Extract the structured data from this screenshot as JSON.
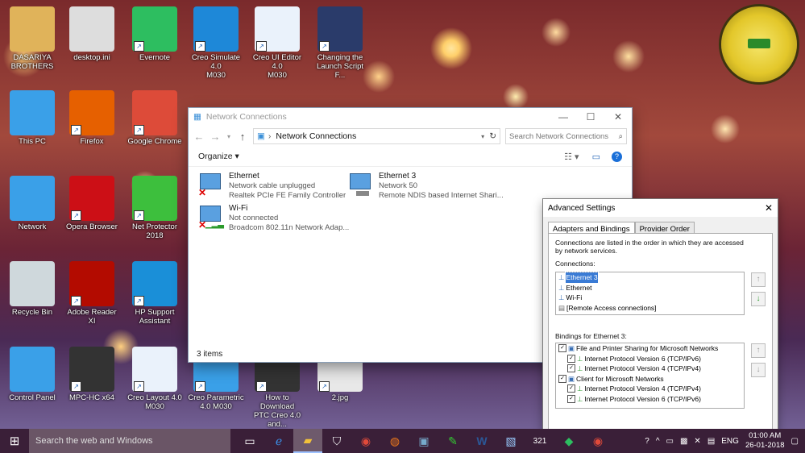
{
  "desktop_icons": [
    {
      "label": "DASARIYA\nBROTHERS",
      "icon": "user-folder-icon",
      "color": "#e0b35a"
    },
    {
      "label": "desktop.ini",
      "icon": "file-icon",
      "color": "#dddddd"
    },
    {
      "label": "Evernote",
      "icon": "evernote-icon",
      "color": "#2dbe60"
    },
    {
      "label": "Creo Simulate 4.0\nM030",
      "icon": "creo-simulate-icon",
      "color": "#1e88d8"
    },
    {
      "label": "Creo UI Editor 4.0\nM030",
      "icon": "creo-ui-editor-icon",
      "color": "#eaf2fb"
    },
    {
      "label": "Changing the\nLaunch Script F...",
      "icon": "video-file-icon",
      "color": "#2a3b6a"
    },
    {
      "label": "This PC",
      "icon": "this-pc-icon",
      "color": "#3aa0e8"
    },
    {
      "label": "Firefox",
      "icon": "firefox-icon",
      "color": "#e66000"
    },
    {
      "label": "Google Chrome",
      "icon": "chrome-icon",
      "color": "#dd4b39"
    },
    {
      "label": "Network",
      "icon": "network-icon",
      "color": "#3aa0e8"
    },
    {
      "label": "Opera Browser",
      "icon": "opera-icon",
      "color": "#cc0f16"
    },
    {
      "label": "Net Protector 2018",
      "icon": "net-protector-icon",
      "color": "#3dbf3d"
    },
    {
      "label": "Recycle Bin",
      "icon": "recycle-bin-icon",
      "color": "#cfd8dc"
    },
    {
      "label": "Adobe Reader XI",
      "icon": "adobe-reader-icon",
      "color": "#b30b00"
    },
    {
      "label": "HP Support\nAssistant",
      "icon": "hp-support-icon",
      "color": "#1a8fd8"
    },
    {
      "label": "Control Panel",
      "icon": "control-panel-icon",
      "color": "#3aa0e8"
    },
    {
      "label": "MPC-HC x64",
      "icon": "mpc-hc-icon",
      "color": "#333333"
    },
    {
      "label": "Creo Layout 4.0\nM030",
      "icon": "creo-layout-icon",
      "color": "#eaf2fb"
    },
    {
      "label": "Creo Parametric\n4.0 M030",
      "icon": "creo-parametric-icon",
      "color": "#3aa0e8"
    },
    {
      "label": "How to Download\nPTC Creo 4.0 and...",
      "icon": "video-file-icon",
      "color": "#333333"
    },
    {
      "label": "2.jpg",
      "icon": "image-file-icon",
      "color": "#e8e8e8"
    }
  ],
  "network_window": {
    "title": "Network Connections",
    "address": "Network Connections",
    "search_placeholder": "Search Network Connections",
    "organize_label": "Organize ▾",
    "status": "3 items",
    "connections": [
      {
        "name": "Ethernet",
        "line1": "Network cable unplugged",
        "line2": "Realtek PCIe FE Family Controller",
        "state": "disconnected"
      },
      {
        "name": "Ethernet 3",
        "line1": "Network  50",
        "line2": "Remote NDIS based Internet Shari...",
        "state": "connected"
      },
      {
        "name": "Wi-Fi",
        "line1": "Not connected",
        "line2": "Broadcom 802.11n Network Adap...",
        "state": "disconnected"
      }
    ]
  },
  "advanced_settings": {
    "title": "Advanced Settings",
    "tabs": [
      "Adapters and Bindings",
      "Provider Order"
    ],
    "description": "Connections are listed in the order in which they are accessed by network services.",
    "connections_label": "Connections:",
    "connections": [
      "Ethernet 3",
      "Ethernet",
      "Wi-Fi",
      "[Remote Access connections]"
    ],
    "bindings_label": "Bindings for Ethernet 3:",
    "bindings": [
      {
        "text": "File and Printer Sharing for Microsoft Networks",
        "level": 0
      },
      {
        "text": "Internet Protocol Version 6 (TCP/IPv6)",
        "level": 1
      },
      {
        "text": "Internet Protocol Version 4 (TCP/IPv4)",
        "level": 1
      },
      {
        "text": "Client for Microsoft Networks",
        "level": 0
      },
      {
        "text": "Internet Protocol Version 4 (TCP/IPv4)",
        "level": 1
      },
      {
        "text": "Internet Protocol Version 6 (TCP/IPv6)",
        "level": 1
      }
    ]
  },
  "taskbar": {
    "search_placeholder": "Search the web and Windows",
    "language": "ENG",
    "time": "01:00 AM",
    "date": "26-01-2018"
  }
}
